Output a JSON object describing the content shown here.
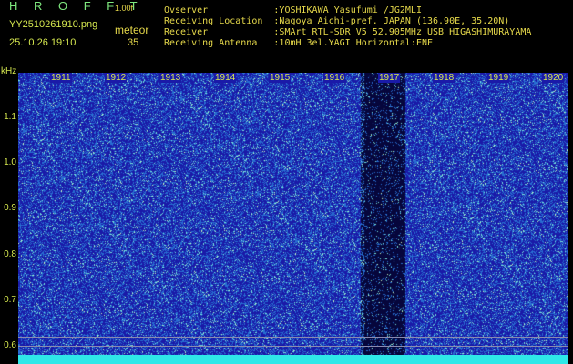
{
  "header": {
    "brand": "H R O F F T",
    "version": "1.00f",
    "filename": "YY2510261910.png",
    "datetime": "25.10.26 19:10",
    "meteor_label": "meteor",
    "meteor_count": "35"
  },
  "info": {
    "overver": "Ovserver            :YOSHIKAWA Yasufumi /JG2MLI",
    "location": "Receiving Location  :Nagoya Aichi-pref. JAPAN (136.90E, 35.20N)",
    "receiver": "Receiver            :SMArt RTL-SDR V5 52.905MHz USB HIGASHIMURAYAMA",
    "antenna": "Receiving Antenna   :10mH 3el.YAGI Horizontal:ENE"
  },
  "axis": {
    "unit": "kHz",
    "y_ticks": [
      "1.1",
      "1.0",
      "0.9",
      "0.8",
      "0.7",
      "0.6"
    ],
    "x_ticks": [
      "1911",
      "1912",
      "1913",
      "1914",
      "1915",
      "1916",
      "1917",
      "1918",
      "1919",
      "1920"
    ]
  },
  "colors": {
    "background": "#1a1aa8",
    "noise": "#2a7ad0",
    "bright": "#7fe8e0",
    "baseline": "#2ee8e8"
  }
}
